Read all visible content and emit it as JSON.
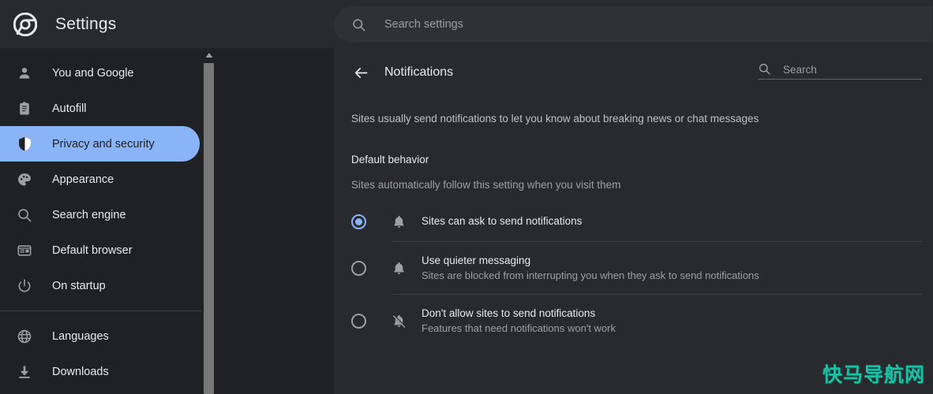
{
  "header": {
    "logo_icon": "chrome-logo-icon",
    "title": "Settings",
    "search": {
      "icon": "search-icon",
      "placeholder": "Search settings",
      "value": ""
    }
  },
  "sidebar": {
    "groups": [
      {
        "items": [
          {
            "icon": "person-icon",
            "label": "You and Google",
            "selected": false
          },
          {
            "icon": "autofill-icon",
            "label": "Autofill",
            "selected": false
          },
          {
            "icon": "shield-icon",
            "label": "Privacy and security",
            "selected": true
          },
          {
            "icon": "palette-icon",
            "label": "Appearance",
            "selected": false
          },
          {
            "icon": "search-icon",
            "label": "Search engine",
            "selected": false
          },
          {
            "icon": "browser-icon",
            "label": "Default browser",
            "selected": false
          },
          {
            "icon": "power-icon",
            "label": "On startup",
            "selected": false
          }
        ]
      },
      {
        "items": [
          {
            "icon": "globe-icon",
            "label": "Languages",
            "selected": false
          },
          {
            "icon": "download-icon",
            "label": "Downloads",
            "selected": false
          }
        ]
      }
    ],
    "scrollbar": {
      "up_arrow_icon": "scroll-up-arrow-icon"
    }
  },
  "main": {
    "back_icon": "back-arrow-icon",
    "title": "Notifications",
    "search": {
      "icon": "search-icon",
      "placeholder": "Search",
      "value": ""
    },
    "intro": "Sites usually send notifications to let you know about breaking news or chat messages",
    "section_title": "Default behavior",
    "section_subtitle": "Sites automatically follow this setting when you visit them",
    "options": [
      {
        "icon": "bell-icon",
        "label": "Sites can ask to send notifications",
        "description": "",
        "selected": true
      },
      {
        "icon": "bell-icon",
        "label": "Use quieter messaging",
        "description": "Sites are blocked from interrupting you when they ask to send notifications",
        "selected": false
      },
      {
        "icon": "bell-off-icon",
        "label": "Don't allow sites to send notifications",
        "description": "Features that need notifications won't work",
        "selected": false
      }
    ]
  },
  "watermark": {
    "text": "快马导航网"
  },
  "colors": {
    "page_bg": "#202124",
    "card_bg": "#292a2d",
    "accent": "#8ab4f8",
    "text_primary": "#e8eaed",
    "text_secondary": "#9aa0a6",
    "divider": "#3c4043",
    "watermark": "#1fbfa6"
  }
}
